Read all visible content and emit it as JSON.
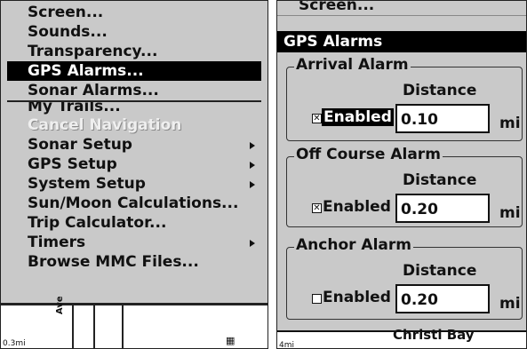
{
  "menu": {
    "items": [
      {
        "label": "Screen...",
        "state": "normal",
        "arrow": false
      },
      {
        "label": "Sounds...",
        "state": "normal",
        "arrow": false
      },
      {
        "label": "Transparency...",
        "state": "normal",
        "arrow": false
      },
      {
        "label": "GPS Alarms...",
        "state": "selected",
        "arrow": false
      },
      {
        "label": "Sonar Alarms...",
        "state": "normal",
        "arrow": false
      },
      {
        "label": "My Trails...",
        "state": "clipped",
        "arrow": false
      },
      {
        "label": "Cancel Navigation",
        "state": "disabled",
        "arrow": false
      },
      {
        "label": "Sonar Setup",
        "state": "normal",
        "arrow": true
      },
      {
        "label": "GPS Setup",
        "state": "normal",
        "arrow": true
      },
      {
        "label": "System Setup",
        "state": "normal",
        "arrow": true
      },
      {
        "label": "Sun/Moon Calculations...",
        "state": "normal",
        "arrow": false
      },
      {
        "label": "Trip Calculator...",
        "state": "normal",
        "arrow": false
      },
      {
        "label": "Timers",
        "state": "normal",
        "arrow": true
      },
      {
        "label": "Browse MMC Files...",
        "state": "normal",
        "arrow": false
      }
    ]
  },
  "left_map": {
    "scale": "0.3mi",
    "road_label": "Ave"
  },
  "dialog": {
    "background_label": "Screen...",
    "title": "GPS Alarms",
    "groups": [
      {
        "title": "Arrival Alarm",
        "distance_label": "Distance",
        "checked": true,
        "check_mark": "✕",
        "enabled_label": "Enabled",
        "focused": true,
        "value": "0.10",
        "unit": "mi"
      },
      {
        "title": "Off Course Alarm",
        "distance_label": "Distance",
        "checked": true,
        "check_mark": "✕",
        "enabled_label": "Enabled",
        "focused": false,
        "value": "0.20",
        "unit": "mi"
      },
      {
        "title": "Anchor Alarm",
        "distance_label": "Distance",
        "checked": false,
        "check_mark": "",
        "enabled_label": "Enabled",
        "focused": false,
        "value": "0.20",
        "unit": "mi"
      }
    ]
  },
  "right_map": {
    "scale": "4mi",
    "place_label": "Christi Bay"
  },
  "colors": {
    "screen_bg": "#c9c9c9",
    "highlight": "#000000",
    "text": "#111111"
  }
}
